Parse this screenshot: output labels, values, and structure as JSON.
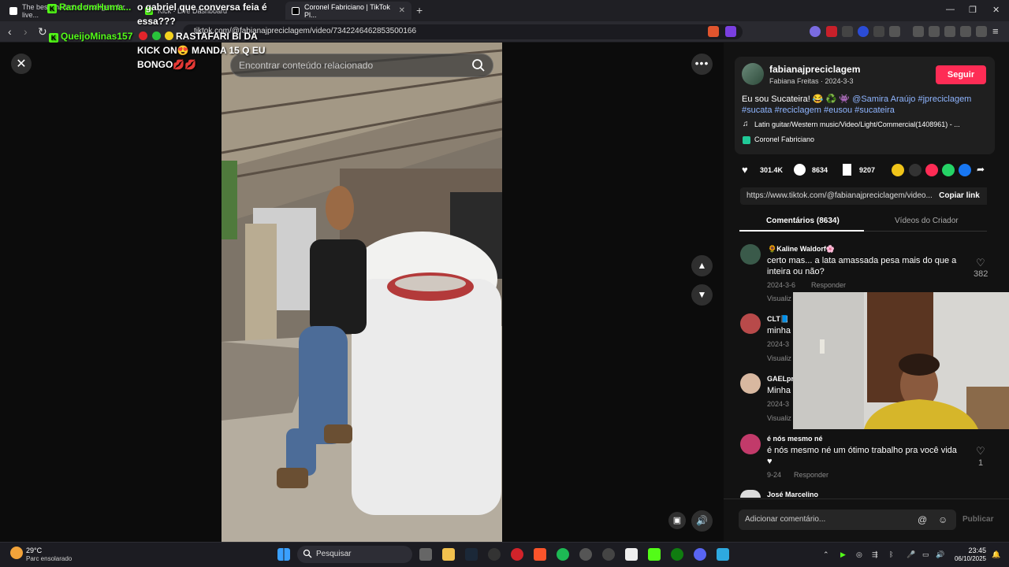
{
  "browser": {
    "tabs": [
      {
        "title": "The best chatbot and widgets for live..."
      },
      {
        "title": "Kick - Live Dashboard"
      },
      {
        "title": "Coronel Fabriciano | TikTok Pl..."
      }
    ],
    "url": "tiktok.com/@fabianajpreciclagem/video/7342246462853500166"
  },
  "overlay_chat": {
    "user1": "RandomHuma...",
    "msg1": "o gabriel que conversa feia é essa???",
    "user2": "QueijoMinas157",
    "msg2_line1": "RASTAFARI BI DA",
    "msg2_line2": "KICK ON😍 MANDA 15 Q EU",
    "msg2_line3": "BONGO💋💋"
  },
  "video": {
    "search_placeholder": "Encontrar conteúdo relacionado",
    "close_glyph": "✕",
    "more_glyph": "•••",
    "up_glyph": "▲",
    "down_glyph": "▼"
  },
  "post": {
    "author": "fabianajpreciclagem",
    "author_sub": "Fabiana Freitas · 2024-3-3",
    "follow_label": "Seguir",
    "caption_line1_text": "Eu sou Sucateira! 😂 ♻️ 👾",
    "caption_mention": "@Samira Araújo",
    "caption_tag1": "#jpreciclagem",
    "caption_tag2": "#sucata",
    "caption_tag3": "#reciclagem",
    "caption_tag4": "#eusou",
    "caption_tag5": "#sucateira",
    "music": "Latin guitar/Western music/Video/Light/Commercial(1408961) - ...",
    "location": "Coronel Fabriciano",
    "likes": "301.4K",
    "comments": "8634",
    "saves": "9207",
    "link": "https://www.tiktok.com/@fabianajpreciclagem/video...",
    "copy_link_label": "Copiar link"
  },
  "panel_tabs": {
    "comments": "Comentários (8634)",
    "creator_videos": "Vídeos do Criador"
  },
  "comments": [
    {
      "name": "🌻Kaline Waldorf🌸",
      "text": "certo mas... a lata amassada pesa mais do que a inteira ou não?",
      "date": "2024-3-6",
      "reply": "Responder",
      "view": "Visualiz",
      "likes": "382"
    },
    {
      "name": "CLT📘",
      "text": "minha",
      "date": "2024-3",
      "view": "Visualiz"
    },
    {
      "name": "GAELpr",
      "text": "Minha",
      "date": "2024-3",
      "view": "Visualiz"
    },
    {
      "name": "é nós mesmo né",
      "text": "é nós mesmo né um ótimo trabalho pra você vida ♥",
      "date": "9-24",
      "reply": "Responder",
      "likes": "1"
    },
    {
      "name": "José Marcelino"
    }
  ],
  "comment_input": {
    "placeholder": "Adicionar comentário...",
    "publish": "Publicar"
  },
  "taskbar": {
    "weather_temp": "29°C",
    "weather_desc": "Parc ensolarado",
    "search": "Pesquisar",
    "time": "23:45",
    "date": "06/10/2025"
  },
  "colors": {
    "follow": "#fe2c55",
    "tag": "#8fb5ff",
    "kick_green": "#53fc18"
  }
}
